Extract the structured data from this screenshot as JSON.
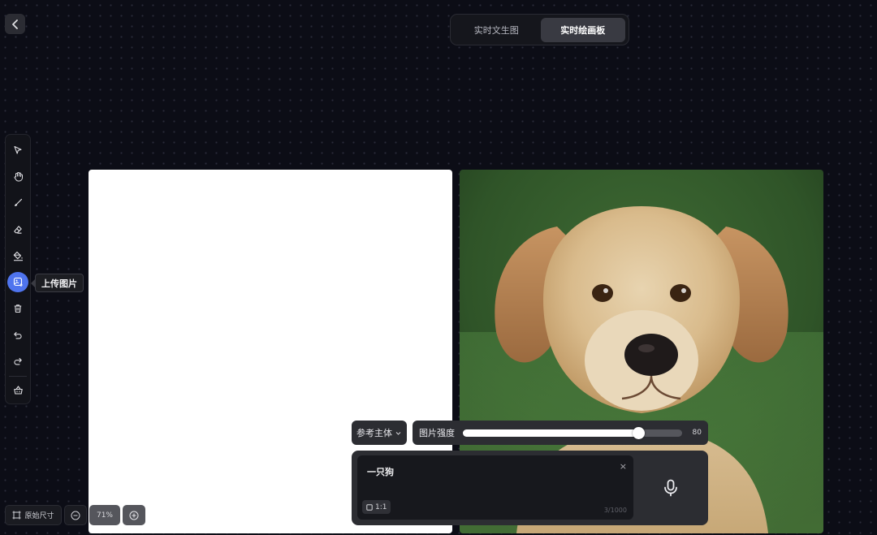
{
  "mode_tabs": [
    {
      "label": "实时文生图",
      "active": false
    },
    {
      "label": "实时绘画板",
      "active": true
    }
  ],
  "toolbar": {
    "tools": [
      "select",
      "hand",
      "brush",
      "eraser",
      "fill",
      "upload-image",
      "delete",
      "undo",
      "redo",
      "clear-canvas"
    ],
    "active_tool": "upload-image",
    "tooltip": "上传图片"
  },
  "controls": {
    "reference_label": "参考主体",
    "strength_label": "图片强度",
    "strength_value": "80",
    "strength_fraction": 0.8
  },
  "prompt": {
    "text": "一只狗",
    "clear": "×",
    "ratio": "1:1",
    "char_count": "3/1000"
  },
  "bottom_bar": {
    "fit_label": "原始尺寸",
    "zoom": "71%"
  },
  "colors": {
    "accent": "#4f74ee",
    "background": "#0c0d16"
  }
}
